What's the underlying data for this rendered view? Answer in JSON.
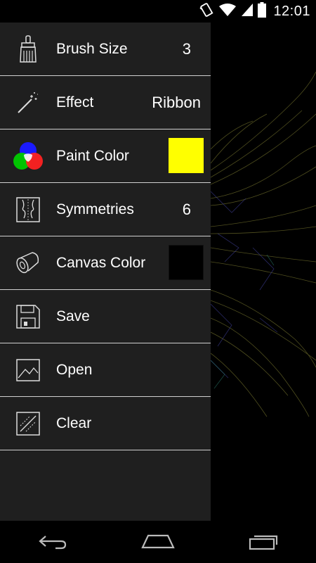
{
  "status_bar": {
    "time": "12:01",
    "icons": [
      "vibrate-icon",
      "wifi-icon",
      "signal-icon",
      "battery-icon"
    ]
  },
  "menu": {
    "items": [
      {
        "label": "Brush Size",
        "value": "3",
        "icon": "paintbrush-icon"
      },
      {
        "label": "Effect",
        "value": "Ribbon",
        "icon": "magic-wand-icon"
      },
      {
        "label": "Paint Color",
        "swatch": "#ffff00",
        "icon": "rgb-circles-icon"
      },
      {
        "label": "Symmetries",
        "value": "6",
        "icon": "symmetry-face-icon"
      },
      {
        "label": "Canvas Color",
        "swatch": "#000000",
        "icon": "canvas-roll-icon"
      },
      {
        "label": "Save",
        "icon": "floppy-disk-icon"
      },
      {
        "label": "Open",
        "icon": "picture-icon"
      },
      {
        "label": "Clear",
        "icon": "clear-frame-icon"
      }
    ]
  },
  "nav_bar": {
    "buttons": [
      "back-icon",
      "home-icon",
      "recents-icon"
    ]
  },
  "colors": {
    "drawer_bg": "#1f1f1f",
    "divider": "#d0d0d0",
    "paint_color": "#ffff00",
    "canvas_color": "#000000"
  }
}
